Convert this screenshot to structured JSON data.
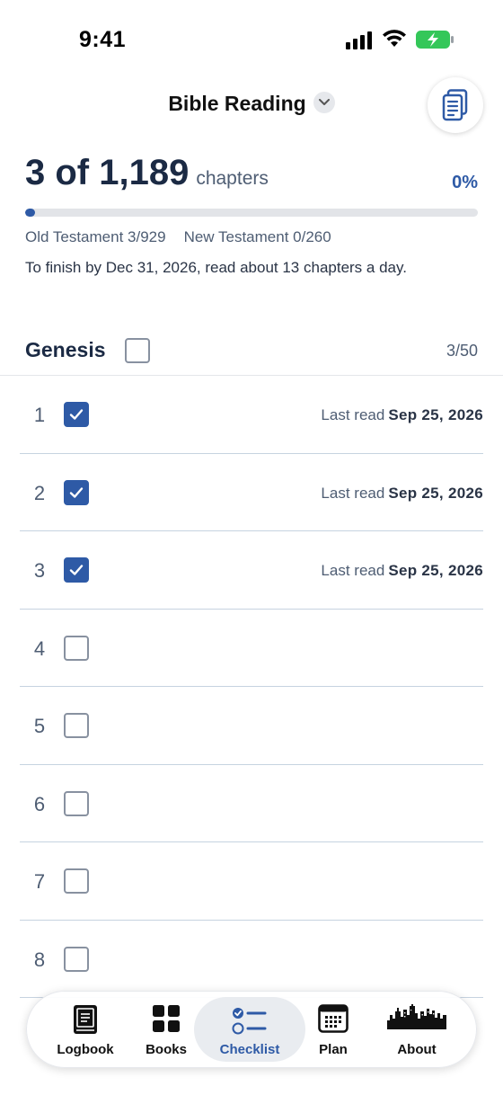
{
  "status_bar": {
    "time": "9:41"
  },
  "header": {
    "title": "Bible Reading"
  },
  "summary": {
    "count": "3 of 1,189",
    "unit": "chapters",
    "percent": "0%",
    "progress_fraction": 0.0025,
    "old_testament": "Old Testament 3/929",
    "new_testament": "New Testament 0/260",
    "finish_note": "To finish by Dec 31, 2026, read about 13 chapters a day."
  },
  "book": {
    "name": "Genesis",
    "count": "3/50"
  },
  "chapters": [
    {
      "num": "1",
      "checked": true,
      "last_label": "Last read",
      "last_date": "Sep 25, 2026"
    },
    {
      "num": "2",
      "checked": true,
      "last_label": "Last read",
      "last_date": "Sep 25, 2026"
    },
    {
      "num": "3",
      "checked": true,
      "last_label": "Last read",
      "last_date": "Sep 25, 2026"
    },
    {
      "num": "4",
      "checked": false,
      "last_label": "",
      "last_date": ""
    },
    {
      "num": "5",
      "checked": false,
      "last_label": "",
      "last_date": ""
    },
    {
      "num": "6",
      "checked": false,
      "last_label": "",
      "last_date": ""
    },
    {
      "num": "7",
      "checked": false,
      "last_label": "",
      "last_date": ""
    },
    {
      "num": "8",
      "checked": false,
      "last_label": "",
      "last_date": ""
    }
  ],
  "tabs": [
    {
      "label": "Logbook",
      "icon": "logbook-icon",
      "active": false
    },
    {
      "label": "Books",
      "icon": "books-grid-icon",
      "active": false
    },
    {
      "label": "Checklist",
      "icon": "checklist-icon",
      "active": true
    },
    {
      "label": "Plan",
      "icon": "calendar-icon",
      "active": false
    },
    {
      "label": "About",
      "icon": "skyline-icon",
      "active": false
    }
  ],
  "colors": {
    "accent": "#2e5aa6",
    "text_primary": "#1b2a44",
    "text_secondary": "#4e5d73",
    "divider": "#c6d3e0",
    "battery": "#34c759"
  }
}
